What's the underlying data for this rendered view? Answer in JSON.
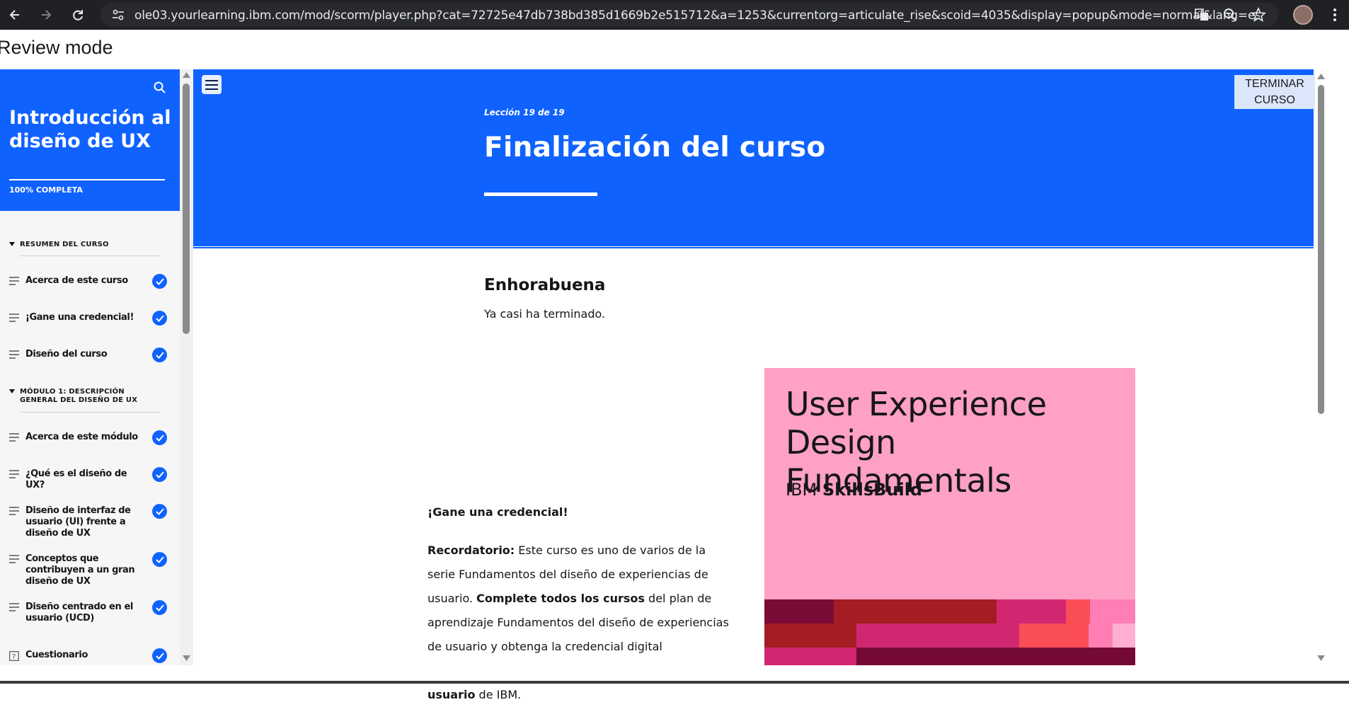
{
  "browser": {
    "url": "ole03.yourlearning.ibm.com/mod/scorm/player.php?cat=72725e47db738bd385d1669b2e515712&a=1253&currentorg=articulate_rise&scoid=4035&display=popup&mode=normal&lang=es"
  },
  "page": {
    "review_mode": "Review mode"
  },
  "sidebar": {
    "course_title": "Introducción al diseño de UX",
    "progress": "100% COMPLETA",
    "progress_value": 1.0,
    "sections": [
      {
        "title": "RESUMEN DEL CURSO",
        "lessons": [
          {
            "label": "Acerca de este curso",
            "complete": true
          },
          {
            "label": "¡Gane una credencial!",
            "complete": true
          },
          {
            "label": "Diseño del curso",
            "complete": true
          }
        ]
      },
      {
        "title": "MÓDULO 1: DESCRIPCIÓN GENERAL DEL DISEÑO DE UX",
        "lessons": [
          {
            "label": "Acerca de este módulo",
            "complete": true
          },
          {
            "label": "¿Qué es el diseño de UX?",
            "complete": true
          },
          {
            "label": "Diseño de interfaz de usuario (UI) frente a diseño de UX",
            "complete": true
          },
          {
            "label": "Conceptos que contribuyen a un gran diseño de UX",
            "complete": true
          },
          {
            "label": "Diseño centrado en el usuario (UCD)",
            "complete": true
          },
          {
            "label": "Cuestionario",
            "complete": true
          }
        ]
      }
    ]
  },
  "header": {
    "lesson_count": "Lección 19 de 19",
    "lesson_title": "Finalización del curso",
    "finish_button": "TERMINAR CURSO"
  },
  "content": {
    "congrats_title": "Enhorabuena",
    "congrats_text": "Ya casi ha terminado.",
    "credential_heading": "¡Gane una credencial!",
    "reminder_label": "Recordatorio:",
    "reminder_text_1": " Este curso es uno de varios de la serie Fundamentos del diseño de experiencias de usuario. ",
    "complete_all": "Complete todos los cursos",
    "reminder_text_2": " del plan de aprendizaje Fundamentos del diseño de experiencias de usuario y obtenga la credencial digital ",
    "credential_name": "Fundamentos del diseño de experiencias de usuario",
    "reminder_text_3": " de IBM."
  },
  "badge": {
    "title": "User Experience Design Fundamentals",
    "brand_prefix": "IBM ",
    "brand_name": "SkillsBuild"
  },
  "colors": {
    "accent": "#0f62fe",
    "badge_bg": "#ffa0c6"
  }
}
